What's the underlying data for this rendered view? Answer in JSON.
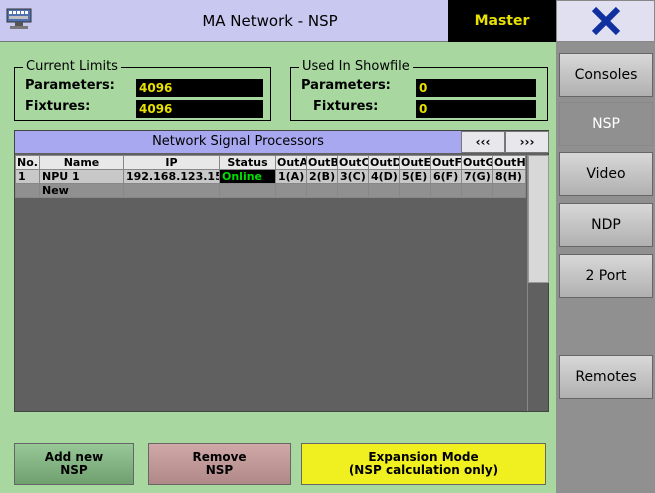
{
  "window": {
    "title": "MA Network - NSP",
    "master_label": "Master"
  },
  "current_limits": {
    "legend": "Current Limits",
    "parameters_label": "Parameters:",
    "parameters_value": "4096",
    "fixtures_label": "Fixtures:",
    "fixtures_value": "4096"
  },
  "used_in_showfile": {
    "legend": "Used In Showfile",
    "parameters_label": "Parameters:",
    "parameters_value": "0",
    "fixtures_label": "Fixtures:",
    "fixtures_value": "0"
  },
  "panel": {
    "title": "Network Signal Processors",
    "prev_label": "‹‹‹",
    "next_label": "›››",
    "columns": [
      "No.",
      "Name",
      "IP",
      "Status",
      "OutA",
      "OutB",
      "OutC",
      "OutD",
      "OutE",
      "OutF",
      "OutG",
      "OutH"
    ],
    "rows": [
      [
        "1",
        "NPU 1",
        "192.168.123.150",
        "Online",
        "1(A)",
        "2(B)",
        "3(C)",
        "4(D)",
        "5(E)",
        "6(F)",
        "7(G)",
        "8(H)"
      ]
    ],
    "new_row_label": "New"
  },
  "sidebar": {
    "items": [
      {
        "label": "Consoles"
      },
      {
        "label": "NSP"
      },
      {
        "label": "Video"
      },
      {
        "label": "NDP"
      },
      {
        "label": "2 Port"
      },
      {
        "label": "Remotes"
      }
    ]
  },
  "buttons": {
    "add_line1": "Add new",
    "add_line2": "NSP",
    "remove_line1": "Remove",
    "remove_line2": "NSP",
    "expansion_line1": "Expansion Mode",
    "expansion_line2": "(NSP calculation only)"
  },
  "colors": {
    "background": "#a8d8a0",
    "accent_yellow": "#f0f020",
    "online_green": "#00e000"
  }
}
